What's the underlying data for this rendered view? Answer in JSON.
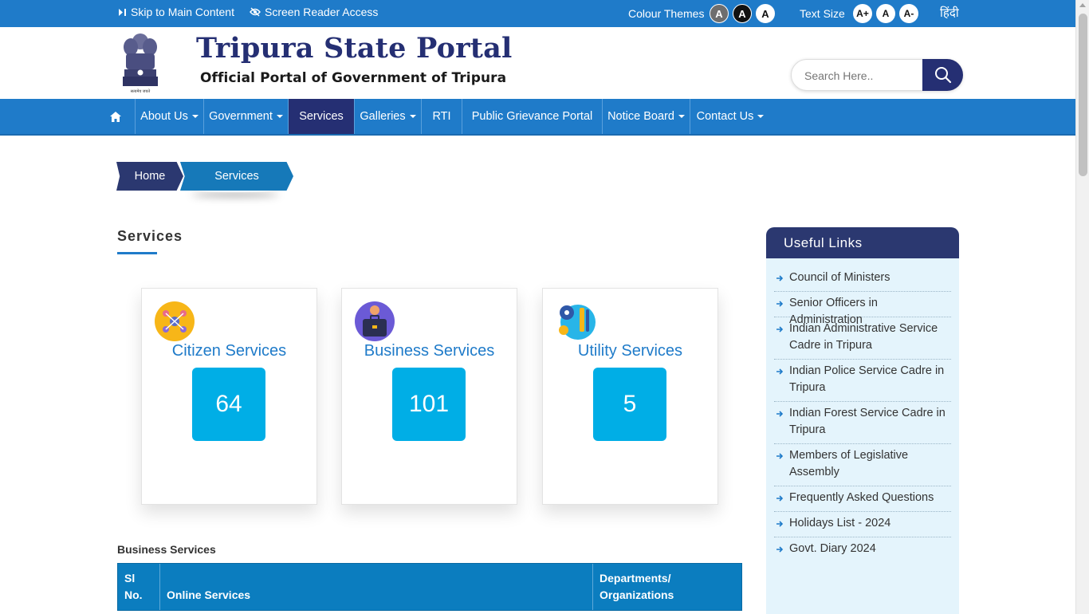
{
  "topbar": {
    "skip_label": "Skip to Main Content",
    "screen_reader_label": "Screen Reader Access",
    "colour_themes_label": "Colour Themes",
    "theme_buttons": [
      "A",
      "A",
      "A"
    ],
    "theme_colors": [
      "#6e6e6e",
      "#111111",
      "#ffffff"
    ],
    "text_size_label": "Text Size",
    "size_buttons": [
      "A+",
      "A",
      "A-"
    ],
    "language_label": "हिंदी"
  },
  "header": {
    "title": "Tripura State Portal",
    "subtitle": "Official Portal of Government of Tripura",
    "emblem_motto": "सत्यमेव जयते",
    "search_placeholder": "Search Here.."
  },
  "nav": {
    "items": [
      {
        "label": "About Us",
        "dropdown": true
      },
      {
        "label": "Government",
        "dropdown": true
      },
      {
        "label": "Services",
        "dropdown": false,
        "active": true
      },
      {
        "label": "Galleries",
        "dropdown": true
      },
      {
        "label": "RTI",
        "dropdown": false
      },
      {
        "label": "Public Grievance Portal",
        "dropdown": false
      },
      {
        "label": "Notice Board",
        "dropdown": true
      },
      {
        "label": "Contact Us",
        "dropdown": true
      }
    ]
  },
  "breadcrumb": {
    "home": "Home",
    "current": "Services"
  },
  "main": {
    "title": "Services",
    "cards": [
      {
        "title": "Citizen Services",
        "count": "64",
        "icon": "citizen-network-icon"
      },
      {
        "title": "Business Services",
        "count": "101",
        "icon": "briefcase-icon"
      },
      {
        "title": "Utility Services",
        "count": "5",
        "icon": "tools-gear-icon"
      }
    ],
    "business_label": "Business Services",
    "table_headers": [
      "Sl No.",
      "Online Services",
      "Departments/ Organizations"
    ]
  },
  "useful_links": {
    "title": "Useful Links",
    "items": [
      "Council of Ministers",
      "Senior Officers in Administration",
      "Indian Administrative Service Cadre in Tripura",
      "Indian Police Service Cadre in Tripura",
      "Indian Forest Service Cadre in Tripura",
      "Members of Legislative Assembly",
      "Frequently Asked Questions",
      "Holidays List - 2024",
      "Govt. Diary 2024"
    ]
  },
  "colors": {
    "primary_blue": "#1f7bc9",
    "navy": "#252f73",
    "count_cyan": "#00aee6",
    "sidebar_bg": "#e4f4fc"
  }
}
